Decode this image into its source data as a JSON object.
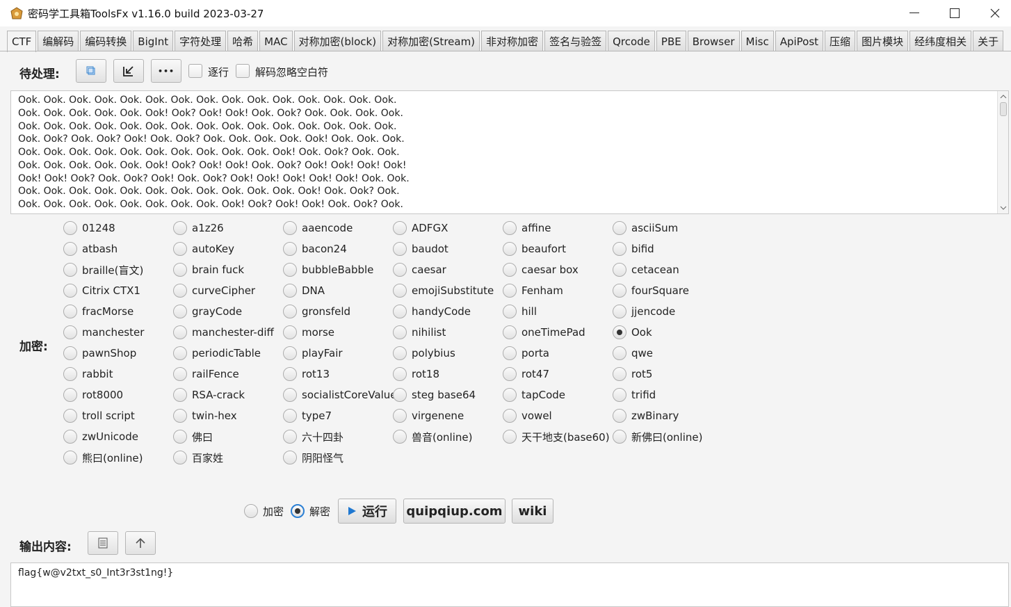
{
  "window": {
    "title": "密码学工具箱ToolsFx v1.16.0 build 2023-03-27",
    "minimize": "—",
    "maximize": "☐",
    "close": "✕"
  },
  "tabs": [
    "CTF",
    "编解码",
    "编码转换",
    "BigInt",
    "字符处理",
    "哈希",
    "MAC",
    "对称加密(block)",
    "对称加密(Stream)",
    "非对称加密",
    "签名与验签",
    "Qrcode",
    "PBE",
    "Browser",
    "Misc",
    "ApiPost",
    "压缩",
    "图片模块",
    "经纬度相关",
    "关于"
  ],
  "input": {
    "label": "待处理:",
    "line_by_line": "逐行",
    "ignore_whitespace": "解码忽略空白符",
    "more_glyph": "•••",
    "lines": [
      "Ook. Ook. Ook. Ook. Ook. Ook. Ook. Ook. Ook. Ook. Ook. Ook. Ook. Ook. Ook.",
      "Ook. Ook. Ook. Ook. Ook. Ook! Ook? Ook! Ook! Ook. Ook? Ook. Ook. Ook. Ook.",
      "Ook. Ook. Ook. Ook. Ook. Ook. Ook. Ook. Ook. Ook. Ook. Ook. Ook. Ook. Ook.",
      "Ook. Ook? Ook. Ook? Ook! Ook. Ook? Ook. Ook. Ook. Ook. Ook! Ook. Ook. Ook.",
      "Ook. Ook. Ook. Ook. Ook. Ook. Ook. Ook. Ook. Ook. Ook! Ook. Ook? Ook. Ook.",
      "Ook. Ook. Ook. Ook. Ook. Ook! Ook? Ook! Ook! Ook. Ook? Ook! Ook! Ook! Ook!",
      "Ook! Ook! Ook? Ook. Ook? Ook! Ook. Ook? Ook! Ook! Ook! Ook! Ook! Ook. Ook.",
      "Ook. Ook. Ook. Ook. Ook. Ook. Ook. Ook. Ook. Ook. Ook. Ook! Ook. Ook? Ook.",
      "Ook. Ook. Ook. Ook. Ook. Ook. Ook. Ook. Ook! Ook? Ook! Ook! Ook. Ook? Ook."
    ]
  },
  "algorithms": {
    "label": "加密:",
    "selected": "Ook",
    "items": [
      "01248",
      "a1z26",
      "aaencode",
      "ADFGX",
      "affine",
      "asciiSum",
      "atbash",
      "autoKey",
      "bacon24",
      "baudot",
      "beaufort",
      "bifid",
      "braille(盲文)",
      "brain fuck",
      "bubbleBabble",
      "caesar",
      "caesar box",
      "cetacean",
      "Citrix CTX1",
      "curveCipher",
      "DNA",
      "emojiSubstitute",
      "Fenham",
      "fourSquare",
      "fracMorse",
      "grayCode",
      "gronsfeld",
      "handyCode",
      "hill",
      "jjencode",
      "manchester",
      "manchester-diff",
      "morse",
      "nihilist",
      "oneTimePad",
      "Ook",
      "pawnShop",
      "periodicTable",
      "playFair",
      "polybius",
      "porta",
      "qwe",
      "rabbit",
      "railFence",
      "rot13",
      "rot18",
      "rot47",
      "rot5",
      "rot8000",
      "RSA-crack",
      "socialistCoreValue",
      "steg base64",
      "tapCode",
      "trifid",
      "troll script",
      "twin-hex",
      "type7",
      "virgenene",
      "vowel",
      "zwBinary",
      "zwUnicode",
      "佛曰",
      "六十四卦",
      "兽音(online)",
      "天干地支(base60)",
      "新佛曰(online)",
      "熊曰(online)",
      "百家姓",
      "阴阳怪气"
    ]
  },
  "actions": {
    "encrypt": "加密",
    "decrypt": "解密",
    "mode": "解密",
    "run": "运行",
    "quipqiup": "quipqiup.com",
    "wiki": "wiki"
  },
  "output": {
    "label": "输出内容:",
    "value": "flag{w@v2txt_s0_Int3r3st1ng!}"
  }
}
